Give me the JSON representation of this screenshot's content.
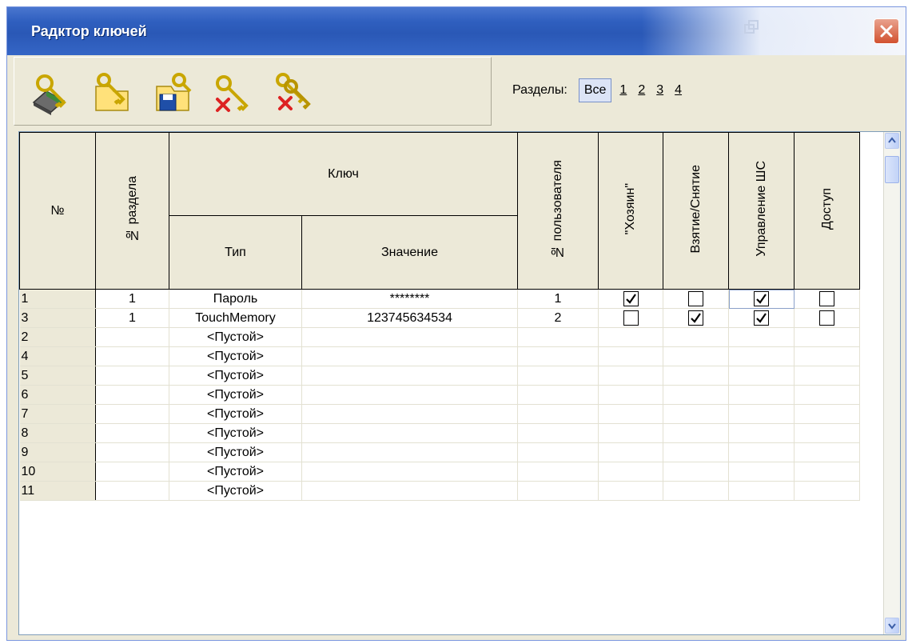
{
  "window": {
    "title": "Радктор ключей"
  },
  "toolbar": {
    "buttons": [
      {
        "name": "key-device-button",
        "icon": "key-device-icon"
      },
      {
        "name": "open-key-button",
        "icon": "key-open-icon"
      },
      {
        "name": "save-key-button",
        "icon": "key-save-icon"
      },
      {
        "name": "delete-key-button",
        "icon": "key-delete-icon"
      },
      {
        "name": "delete-all-keys-button",
        "icon": "keys-delete-all-icon"
      }
    ]
  },
  "sections": {
    "label": "Разделы:",
    "all": "Все",
    "items": [
      "1",
      "2",
      "3",
      "4"
    ]
  },
  "table": {
    "headers": {
      "number": "№",
      "section": "№ раздела",
      "key": "Ключ",
      "type": "Тип",
      "value": "Значение",
      "user": "№ пользователя",
      "owner": "\"Хозяин\"",
      "arm": "Взятие/Снятие",
      "control": "Управление ШС",
      "access": "Доступ"
    },
    "rows": [
      {
        "num": "1",
        "section": "1",
        "type": "Пароль",
        "value": "********",
        "user": "1",
        "owner": true,
        "arm": false,
        "control": true,
        "access": false
      },
      {
        "num": "3",
        "section": "1",
        "type": "TouchMemory",
        "value": "123745634534",
        "user": "2",
        "owner": false,
        "arm": true,
        "control": true,
        "access": false
      },
      {
        "num": "2",
        "section": "",
        "type": "<Пустой>",
        "value": "",
        "user": ""
      },
      {
        "num": "4",
        "section": "",
        "type": "<Пустой>",
        "value": "",
        "user": ""
      },
      {
        "num": "5",
        "section": "",
        "type": "<Пустой>",
        "value": "",
        "user": ""
      },
      {
        "num": "6",
        "section": "",
        "type": "<Пустой>",
        "value": "",
        "user": ""
      },
      {
        "num": "7",
        "section": "",
        "type": "<Пустой>",
        "value": "",
        "user": ""
      },
      {
        "num": "8",
        "section": "",
        "type": "<Пустой>",
        "value": "",
        "user": ""
      },
      {
        "num": "9",
        "section": "",
        "type": "<Пустой>",
        "value": "",
        "user": ""
      },
      {
        "num": "10",
        "section": "",
        "type": "<Пустой>",
        "value": "",
        "user": ""
      },
      {
        "num": "11",
        "section": "",
        "type": "<Пустой>",
        "value": "",
        "user": ""
      }
    ]
  },
  "colors": {
    "titlebar": "#2f5fbf",
    "chrome": "#ece9d8",
    "close": "#d2512f",
    "selected": "#dce4f6"
  }
}
